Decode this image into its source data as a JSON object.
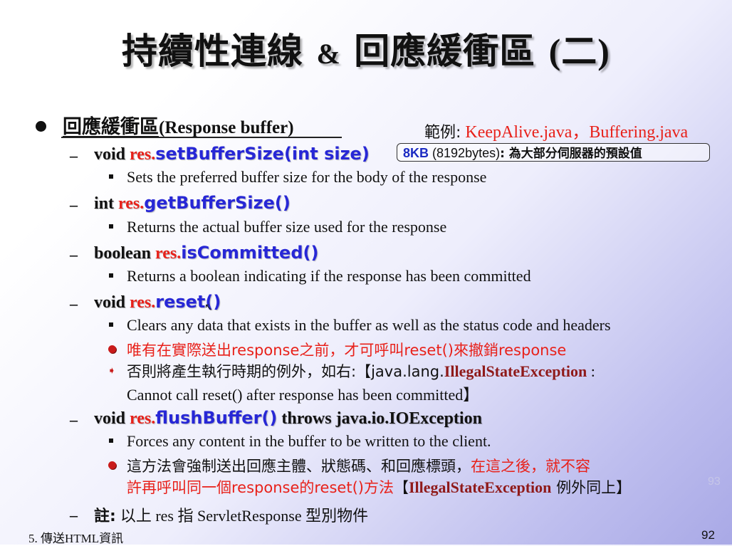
{
  "title": {
    "part1": "持續性連線",
    "amp": "&",
    "part2": "回應緩衝區",
    "paren": "(二)"
  },
  "bullet1": {
    "label_cjk": "回應緩衝區",
    "label_eng": "(Response buffer)"
  },
  "example": {
    "prefix": "範例:",
    "files": "KeepAlive.java，Buffering.java"
  },
  "items": [
    {
      "ret": "void",
      "obj": "res.",
      "method": "setBufferSize(int size)",
      "desc": "Sets the preferred buffer size for the body of the response"
    },
    {
      "ret": "int",
      "obj": "res.",
      "method": "getBufferSize()",
      "desc": "Returns the actual buffer size used for the response"
    },
    {
      "ret": "boolean",
      "obj": "res.",
      "method": "isCommitted()",
      "desc": "Returns a boolean indicating if the response has been committed"
    },
    {
      "ret": "void",
      "obj": "res.",
      "method": "reset()",
      "desc": "Clears any data that exists in the buffer as well as the status code and headers"
    },
    {
      "ret": "void",
      "obj": "res.",
      "method": "flushBuffer()",
      "throws": "throws java.io.IOException",
      "desc": "Forces any content in the buffer to be written to the client."
    }
  ],
  "default_note": {
    "size": "8KB",
    "bytes": "(8192bytes)",
    "text": ": 為大部分伺服器的預設值"
  },
  "reset_notes": {
    "note1": "唯有在實際送出response之前，才可呼叫reset()來撤銷response",
    "note2_a": "否則將產生執行時期的例外，如右:【java.lang.",
    "note2_exc": "IllegalStateException",
    "note2_b": " :",
    "note2_line2": "Cannot call reset() after response has been committed】"
  },
  "flush_notes": {
    "line1_black": "這方法會強制送出回應主體、狀態碼、和回應標頭，",
    "line1_red": "在這之後，就不容",
    "line2_red": "許再呼叫同一個response的reset()方法",
    "line2_a": "【",
    "line2_exc": "IllegalStateException",
    "line2_b": " 例外同上】"
  },
  "footnote": {
    "label": "註:",
    "text": "以上 res 指 ServletResponse 型別物件"
  },
  "footer": {
    "left": "5. 傳送HTML資訊",
    "page": "92"
  },
  "ghost_number": "93",
  "colors": {
    "accent_red": "#e8211a",
    "api_blue": "#2727d6",
    "exception_red": "#8f1a1a"
  }
}
